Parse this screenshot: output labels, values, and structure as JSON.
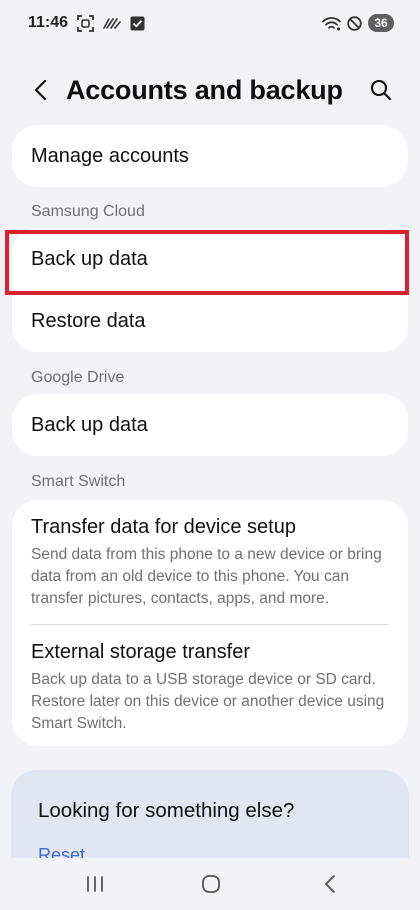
{
  "status_bar": {
    "time": "11:46",
    "battery_level": "36",
    "icons": [
      "screenshot-icon",
      "scribble-icon",
      "checkbox-icon",
      "wifi-icon",
      "do-not-disturb-icon"
    ]
  },
  "header": {
    "title": "Accounts and backup",
    "back_icon": "chevron-left-icon",
    "search_icon": "search-icon"
  },
  "manage": {
    "label": "Manage accounts"
  },
  "samsung_cloud": {
    "header": "Samsung Cloud",
    "backup_label": "Back up data",
    "restore_label": "Restore data"
  },
  "google_drive": {
    "header": "Google Drive",
    "backup_label": "Back up data"
  },
  "smart_switch": {
    "header": "Smart Switch",
    "transfer_title": "Transfer data for device setup",
    "transfer_desc": "Send data from this phone to a new device or bring data from an old device to this phone. You can transfer pictures, contacts, apps, and more.",
    "external_title": "External storage transfer",
    "external_desc": "Back up data to a USB storage device or SD card. Restore later on this device or another device using Smart Switch."
  },
  "suggestions": {
    "title": "Looking for something else?",
    "link": "Reset"
  },
  "nav": {
    "recents_icon": "recents-icon",
    "home_icon": "home-icon",
    "back_icon": "back-icon"
  },
  "colors": {
    "background": "#f3f2f7",
    "card": "#ffffff",
    "highlight": "#d8222e",
    "link": "#3b6ccf",
    "suggest_card": "#e2e6f3"
  }
}
